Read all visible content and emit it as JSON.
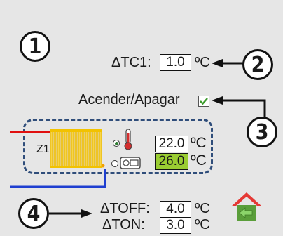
{
  "markers": {
    "m1": "1",
    "m2": "2",
    "m3": "3",
    "m4": "4"
  },
  "tc1": {
    "label": "ΔTC1:",
    "value": "1.0",
    "unit": "ºC"
  },
  "toggle": {
    "label": "Acender/Apagar",
    "checked": true
  },
  "zone": {
    "name": "Z1",
    "temp_value": "22.0",
    "temp_unit": "ºC",
    "setpoint_value": "26.0",
    "setpoint_unit": "ºC"
  },
  "toff": {
    "label": "ΔTOFF:",
    "value": "4.0",
    "unit": "ºC"
  },
  "ton": {
    "label": "ΔTON:",
    "value": "3.0",
    "unit": "ºC"
  },
  "colors": {
    "hot_pipe": "#e01010",
    "cold_pipe": "#1f3fd0",
    "radiator": "#f2c200",
    "setpoint_bg": "#9acd32",
    "dash": "#2f4d7a",
    "home_roof": "#e53935",
    "home_body": "#5a9e3a"
  },
  "icons": {
    "thermometer": "thermometer-icon",
    "heater": "heater-icon",
    "home": "home-icon",
    "check": "check-icon"
  }
}
